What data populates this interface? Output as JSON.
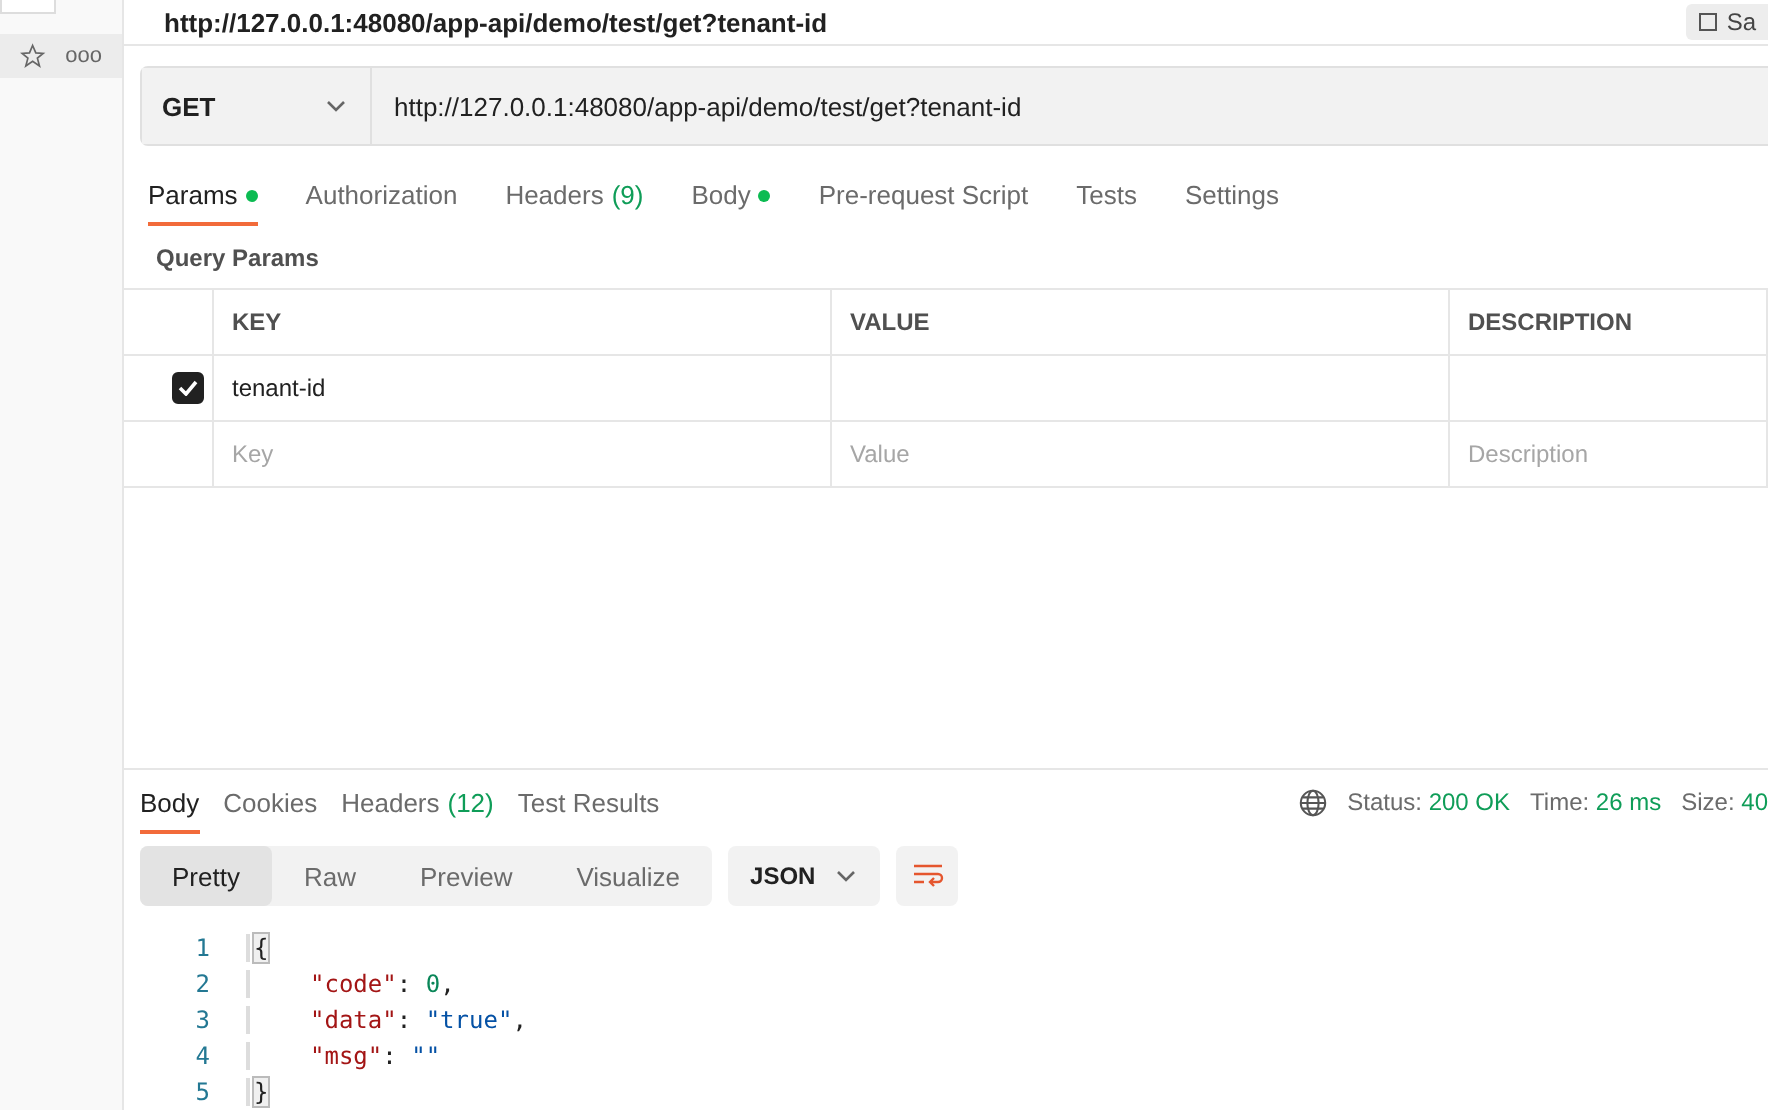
{
  "sidebar": {
    "items": [
      {
        "label": "ooo",
        "selected": true
      }
    ]
  },
  "request_title": "http://127.0.0.1:48080/app-api/demo/test/get?tenant-id",
  "save_button": "Sa",
  "method": "GET",
  "url": "http://127.0.0.1:48080/app-api/demo/test/get?tenant-id",
  "request_tabs": [
    {
      "label": "Params",
      "dot": true,
      "selected": true
    },
    {
      "label": "Authorization",
      "dot": false,
      "selected": false
    },
    {
      "label": "Headers",
      "count": "(9)",
      "dot": false,
      "selected": false
    },
    {
      "label": "Body",
      "dot": true,
      "selected": false
    },
    {
      "label": "Pre-request Script",
      "dot": false,
      "selected": false
    },
    {
      "label": "Tests",
      "dot": false,
      "selected": false
    },
    {
      "label": "Settings",
      "dot": false,
      "selected": false
    }
  ],
  "params_title": "Query Params",
  "params_table": {
    "columns": [
      "KEY",
      "VALUE",
      "DESCRIPTION"
    ],
    "rows": [
      {
        "checked": true,
        "key": "tenant-id"
      }
    ],
    "placeholders": [
      "Key",
      "Value",
      "Description"
    ]
  },
  "response_tabs": [
    {
      "label": "Body",
      "selected": true
    },
    {
      "label": "Cookies",
      "selected": false
    },
    {
      "label": "Headers",
      "count": "(12)",
      "selected": false
    },
    {
      "label": "Test Results",
      "selected": false
    }
  ],
  "status": [
    {
      "label": "Status:",
      "value": "200 OK"
    },
    {
      "label": "Time:",
      "value": "26 ms"
    },
    {
      "label": "Size:",
      "value": "40"
    }
  ],
  "view_modes": [
    {
      "label": "Pretty",
      "selected": true
    },
    {
      "label": "Raw",
      "selected": false
    },
    {
      "label": "Preview",
      "selected": false
    },
    {
      "label": "Visualize",
      "selected": false
    }
  ],
  "format": "JSON",
  "code": [
    {
      "number": "1",
      "indent": false,
      "tokens": [
        {
          "t": "{",
          "kind": "brace"
        }
      ]
    },
    {
      "number": "2",
      "indent": true,
      "tokens": [
        {
          "t": "\"code\"",
          "kind": "key"
        },
        {
          "t": ":",
          "kind": "punct"
        },
        {
          "t": "0",
          "kind": "number"
        },
        {
          "t": ",",
          "kind": "punct"
        }
      ]
    },
    {
      "number": "3",
      "indent": true,
      "tokens": [
        {
          "t": "\"data\"",
          "kind": "key"
        },
        {
          "t": ":",
          "kind": "punct"
        },
        {
          "t": "\"true\"",
          "kind": "string"
        },
        {
          "t": ",",
          "kind": "punct"
        }
      ]
    },
    {
      "number": "4",
      "indent": true,
      "tokens": [
        {
          "t": "\"msg\"",
          "kind": "key"
        },
        {
          "t": ":",
          "kind": "punct"
        },
        {
          "t": "\"\"",
          "kind": "string"
        }
      ]
    },
    {
      "number": "5",
      "indent": false,
      "tokens": [
        {
          "t": "}",
          "kind": "brace"
        }
      ]
    }
  ]
}
